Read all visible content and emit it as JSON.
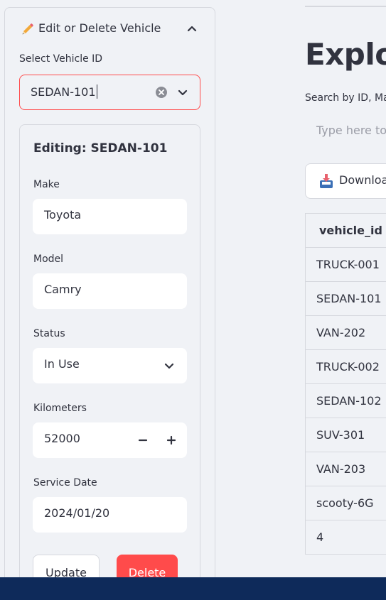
{
  "sidebar": {
    "expander": {
      "title": "Edit or Delete Vehicle",
      "icon": "pencil-icon",
      "collapse_icon": "chevron-up-icon"
    },
    "select_vehicle": {
      "label": "Select Vehicle ID",
      "value": "SEDAN-101"
    },
    "form": {
      "heading": "Editing: SEDAN-101",
      "make": {
        "label": "Make",
        "value": "Toyota"
      },
      "model": {
        "label": "Model",
        "value": "Camry"
      },
      "status": {
        "label": "Status",
        "value": "In Use"
      },
      "kilometers": {
        "label": "Kilometers",
        "value": "52000",
        "minus": "−",
        "plus": "+"
      },
      "service_date": {
        "label": "Service Date",
        "value": "2024/01/20"
      },
      "update_label": "Update",
      "delete_label": "Delete"
    }
  },
  "main": {
    "title": "Explor",
    "search_label": "Search by ID, Ma",
    "search_placeholder": "Type here to",
    "download_label": "Downloa",
    "table": {
      "header": "vehicle_id",
      "rows": [
        "TRUCK-001",
        "SEDAN-101",
        "VAN-202",
        "TRUCK-002",
        "SEDAN-102",
        "SUV-301",
        "VAN-203",
        "scooty-6G",
        "4"
      ]
    }
  },
  "colors": {
    "accent": "#ff4b4b",
    "background": "#f0f2f6",
    "text": "#31333f",
    "bottom_bar": "#0e2a5a"
  }
}
